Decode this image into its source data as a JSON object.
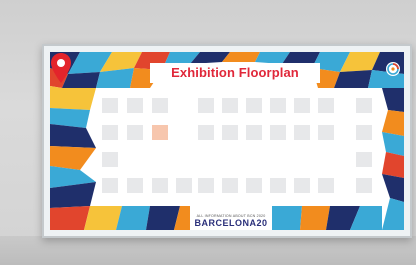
{
  "floorplan": {
    "title": "Exhibition Floorplan",
    "event_small_text": "ALL INFORMATION ABOUT BCN 2020",
    "event_logo": "BARCELONA20"
  },
  "icons": {
    "location_pin": "location-pin-icon",
    "corner_badge": "target-icon"
  },
  "colors": {
    "title_red": "#e0283a",
    "pin_red": "#e3242b",
    "booth_grey": "#e7e8ea",
    "booth_highlight": "#f7c6ad",
    "mosaic_blue": "#3aa9d6",
    "mosaic_navy": "#1f2f6b",
    "mosaic_orange": "#f28c1e",
    "mosaic_red": "#e1452d",
    "mosaic_yellow": "#f6c33a"
  }
}
